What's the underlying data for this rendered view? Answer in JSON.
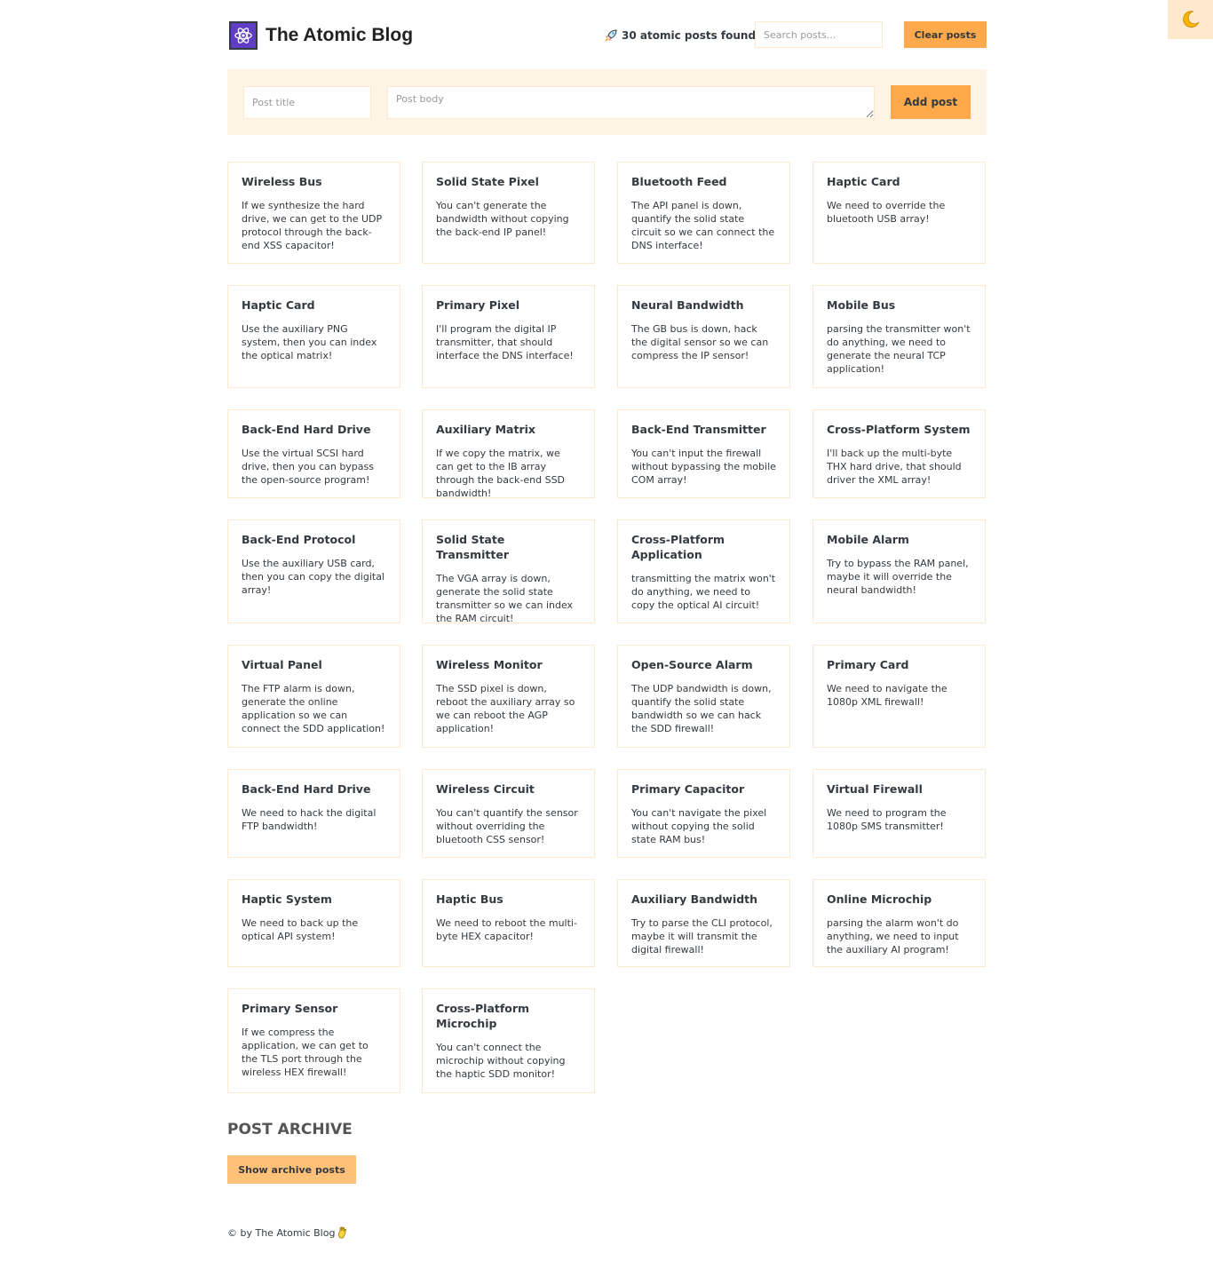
{
  "header": {
    "title": "The Atomic Blog",
    "posts_found": "30 atomic posts found",
    "search_placeholder": "Search posts...",
    "clear_label": "Clear posts"
  },
  "form": {
    "title_placeholder": "Post title",
    "body_placeholder": "Post body",
    "add_label": "Add post"
  },
  "posts": [
    {
      "title": "Wireless Bus",
      "body": "If we synthesize the hard drive, we can get to the UDP protocol through the back-end XSS capacitor!"
    },
    {
      "title": "Solid State Pixel",
      "body": "You can't generate the bandwidth without copying the back-end IP panel!"
    },
    {
      "title": "Bluetooth Feed",
      "body": "The API panel is down, quantify the solid state circuit so we can connect the DNS interface!"
    },
    {
      "title": "Haptic Card",
      "body": "We need to override the bluetooth USB array!"
    },
    {
      "title": "Haptic Card",
      "body": "Use the auxiliary PNG system, then you can index the optical matrix!"
    },
    {
      "title": "Primary Pixel",
      "body": "I'll program the digital IP transmitter, that should interface the DNS interface!"
    },
    {
      "title": "Neural Bandwidth",
      "body": "The GB bus is down, hack the digital sensor so we can compress the IP sensor!"
    },
    {
      "title": "Mobile Bus",
      "body": "parsing the transmitter won't do anything, we need to generate the neural TCP application!"
    },
    {
      "title": "Back-End Hard Drive",
      "body": "Use the virtual SCSI hard drive, then you can bypass the open-source program!"
    },
    {
      "title": "Auxiliary Matrix",
      "body": "If we copy the matrix, we can get to the IB array through the back-end SSD bandwidth!"
    },
    {
      "title": "Back-End Transmitter",
      "body": "You can't input the firewall without bypassing the mobile COM array!"
    },
    {
      "title": "Cross-Platform System",
      "body": "I'll back up the multi-byte THX hard drive, that should driver the XML array!"
    },
    {
      "title": "Back-End Protocol",
      "body": "Use the auxiliary USB card, then you can copy the digital array!"
    },
    {
      "title": "Solid State Transmitter",
      "body": "The VGA array is down, generate the solid state transmitter so we can index the RAM circuit!"
    },
    {
      "title": "Cross-Platform Application",
      "body": "transmitting the matrix won't do anything, we need to copy the optical AI circuit!"
    },
    {
      "title": "Mobile Alarm",
      "body": "Try to bypass the RAM panel, maybe it will override the neural bandwidth!"
    },
    {
      "title": "Virtual Panel",
      "body": "The FTP alarm is down, generate the online application so we can connect the SDD application!"
    },
    {
      "title": "Wireless Monitor",
      "body": "The SSD pixel is down, reboot the auxiliary array so we can reboot the AGP application!"
    },
    {
      "title": "Open-Source Alarm",
      "body": "The UDP bandwidth is down, quantify the solid state bandwidth so we can hack the SDD firewall!"
    },
    {
      "title": "Primary Card",
      "body": "We need to navigate the 1080p XML firewall!"
    },
    {
      "title": "Back-End Hard Drive",
      "body": "We need to hack the digital FTP bandwidth!"
    },
    {
      "title": "Wireless Circuit",
      "body": "You can't quantify the sensor without overriding the bluetooth CSS sensor!"
    },
    {
      "title": "Primary Capacitor",
      "body": "You can't navigate the pixel without copying the solid state RAM bus!"
    },
    {
      "title": "Virtual Firewall",
      "body": "We need to program the 1080p SMS transmitter!"
    },
    {
      "title": "Haptic System",
      "body": "We need to back up the optical API system!"
    },
    {
      "title": "Haptic Bus",
      "body": "We need to reboot the multi-byte HEX capacitor!"
    },
    {
      "title": "Auxiliary Bandwidth",
      "body": "Try to parse the CLI protocol, maybe it will transmit the digital firewall!"
    },
    {
      "title": "Online Microchip",
      "body": "parsing the alarm won't do anything, we need to input the auxiliary AI program!"
    },
    {
      "title": "Primary Sensor",
      "body": "If we compress the application, we can get to the TLS port through the wireless HEX firewall!"
    },
    {
      "title": "Cross-Platform Microchip",
      "body": "You can't connect the microchip without copying the haptic SDD monitor!"
    }
  ],
  "archive": {
    "heading": "POST ARCHIVE",
    "button_label": "Show archive posts"
  },
  "footer": {
    "text": "© by The Atomic Blog"
  },
  "colors": {
    "accent": "#ffa94d",
    "panel": "#fff4e6",
    "border": "#ffe8cc",
    "logo": "#5f3dc4"
  }
}
